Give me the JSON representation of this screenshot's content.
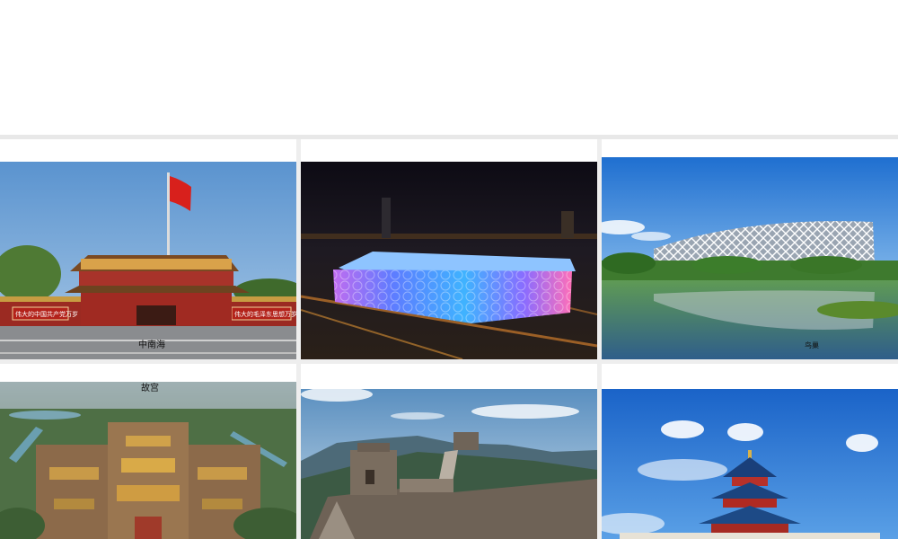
{
  "gallery": {
    "items": [
      {
        "caption": "中南海",
        "subject": "zhongnanhai-gate"
      },
      {
        "caption": "",
        "subject": "water-cube-night"
      },
      {
        "caption": "鸟巢",
        "subject": "birds-nest-stadium"
      },
      {
        "caption": "故宫",
        "subject": "forbidden-city-aerial"
      },
      {
        "caption": "",
        "subject": "great-wall"
      },
      {
        "caption": "",
        "subject": "temple-of-heaven"
      }
    ],
    "flag_banner_left": "伟大的中国共产党万岁",
    "flag_banner_right": "伟大的毛泽东思想万岁"
  }
}
